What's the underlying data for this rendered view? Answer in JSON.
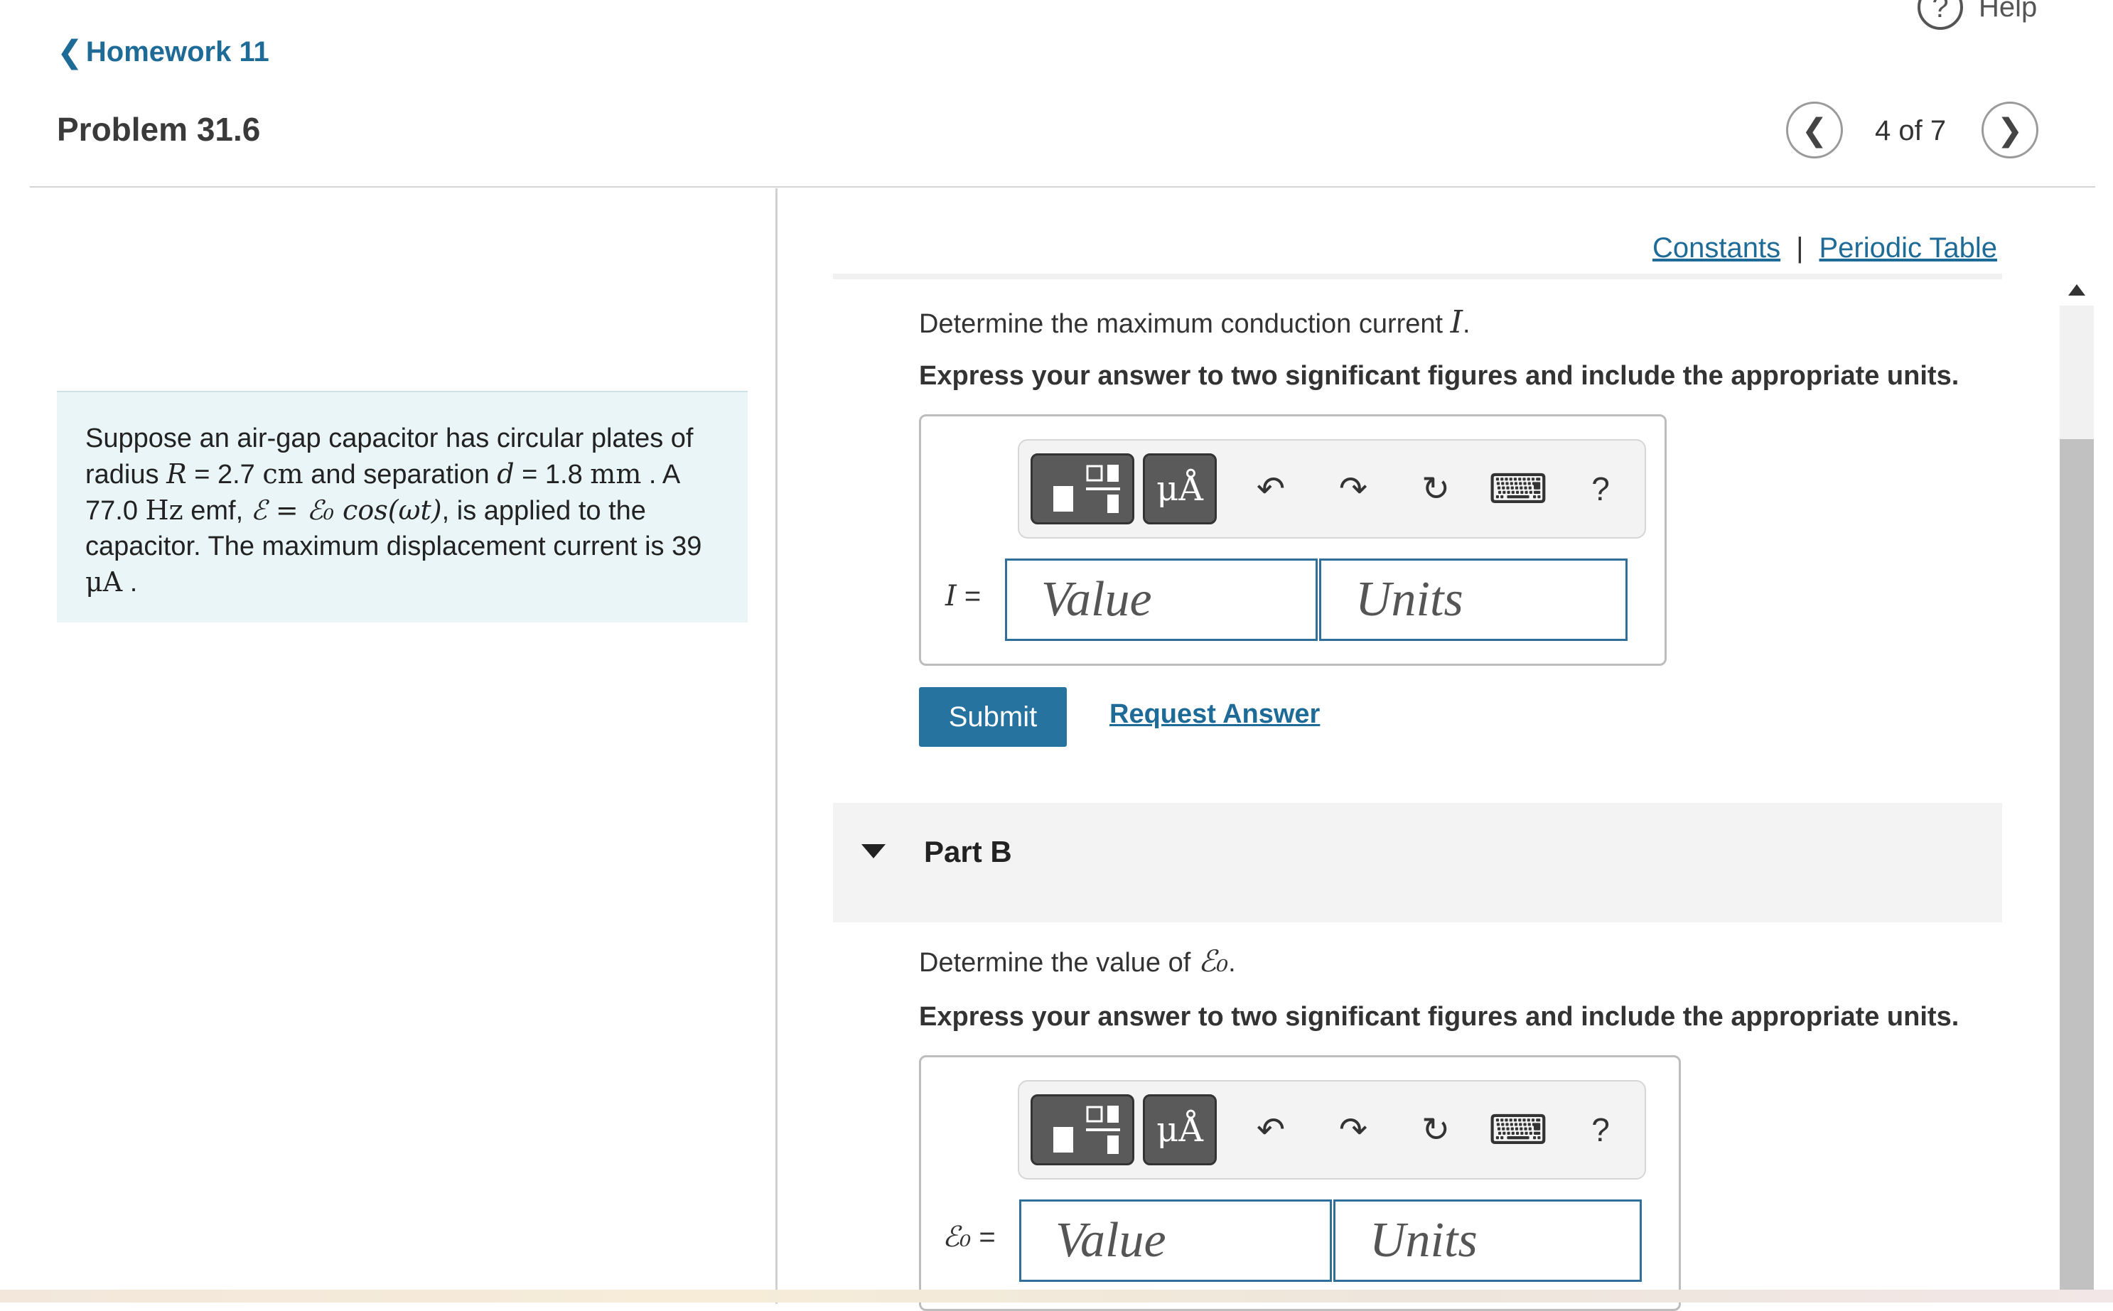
{
  "header": {
    "help_icon": "?",
    "help_label": "Help",
    "back_chevron": "❮",
    "back_label": "Homework 11",
    "problem_title": "Problem 31.6",
    "prev_symbol": "❮",
    "next_symbol": "❯",
    "counter": "4 of 7"
  },
  "resources": {
    "constants": "Constants",
    "separator": "|",
    "periodic_table": "Periodic Table"
  },
  "problem": {
    "t1": "Suppose an air-gap capacitor has circular plates of radius ",
    "R": "R",
    "t2": " = 2.7 ",
    "cm": "cm",
    "t3": " and separation ",
    "d": "d",
    "t4": " = 1.8 ",
    "mm": "mm",
    "t5": " . A 77.0 ",
    "Hz": "Hz",
    "t6": " emf, ",
    "emf_eq": "ℰ = ℰ₀ cos(ωt)",
    "t7": ", is applied to the capacitor. The maximum displacement current is 39 ",
    "uA": "μA",
    "t8": " ."
  },
  "partA": {
    "prompt_text": "Determine the maximum conduction current ",
    "prompt_var": "I",
    "prompt_end": ".",
    "instruction": "Express your answer to two significant figures and include the appropriate units.",
    "var_label": "I",
    "var_eq": " =",
    "value_placeholder": "Value",
    "units_placeholder": "Units",
    "submit": "Submit",
    "request": "Request Answer"
  },
  "partB": {
    "title": "Part B",
    "prompt_text": "Determine the value of ",
    "prompt_var": "ℰ₀",
    "prompt_end": ".",
    "instruction": "Express your answer to two significant figures and include the appropriate units.",
    "var_label": "ℰ₀",
    "var_eq": " =",
    "value_placeholder": "Value",
    "units_placeholder": "Units"
  },
  "toolbar": {
    "units_symbol": "μÅ",
    "undo": "↶",
    "redo": "↷",
    "reset": "↻",
    "keyboard": "⌨",
    "help": "?"
  },
  "icons": {
    "template": "template-icon",
    "units": "units-icon",
    "undo": "undo-icon",
    "redo": "redo-icon",
    "reset": "reset-icon",
    "keyboard": "keyboard-icon",
    "help": "help-icon"
  }
}
